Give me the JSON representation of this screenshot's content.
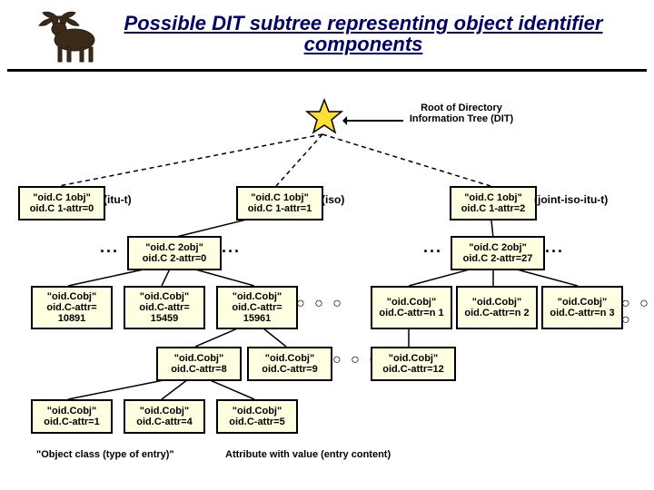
{
  "title_line": "Possible DIT subtree representing object identifier components",
  "root_label": "Root of Directory Information Tree (DIT)",
  "row1": {
    "a": {
      "l1": "\"oid.C 1obj\"",
      "l2": "oid.C 1-attr=0",
      "side": "(itu-t)"
    },
    "b": {
      "l1": "\"oid.C 1obj\"",
      "l2": "oid.C 1-attr=1",
      "side": "(iso)"
    },
    "c": {
      "l1": "\"oid.C 1obj\"",
      "l2": "oid.C 1-attr=2",
      "side": "(joint-iso-itu-t)"
    }
  },
  "row2": {
    "a": {
      "l1": "\"oid.C 2obj\"",
      "l2": "oid.C 2-attr=0"
    },
    "b": {
      "l1": "\"oid.C 2obj\"",
      "l2": "oid.C 2-attr=27"
    }
  },
  "row3": {
    "a": {
      "l1": "\"oid.Cobj\"",
      "l2": "oid.C-attr= 10891"
    },
    "b": {
      "l1": "\"oid.Cobj\"",
      "l2": "oid.C-attr= 15459"
    },
    "c": {
      "l1": "\"oid.Cobj\"",
      "l2": "oid.C-attr= 15961"
    },
    "d": {
      "l1": "\"oid.Cobj\"",
      "l2": "oid.C-attr=n 1"
    },
    "e": {
      "l1": "\"oid.Cobj\"",
      "l2": "oid.C-attr=n 2"
    },
    "f": {
      "l1": "\"oid.Cobj\"",
      "l2": "oid.C-attr=n 3"
    }
  },
  "row4": {
    "a": {
      "l1": "\"oid.Cobj\"",
      "l2": "oid.C-attr=8"
    },
    "b": {
      "l1": "\"oid.Cobj\"",
      "l2": "oid.C-attr=9"
    },
    "c": {
      "l1": "\"oid.Cobj\"",
      "l2": "oid.C-attr=12"
    }
  },
  "row5": {
    "a": {
      "l1": "\"oid.Cobj\"",
      "l2": "oid.C-attr=1"
    },
    "b": {
      "l1": "\"oid.Cobj\"",
      "l2": "oid.C-attr=4"
    },
    "c": {
      "l1": "\"oid.Cobj\"",
      "l2": "oid.C-attr=5"
    }
  },
  "legend": {
    "class_label": "\"Object class (type of entry)\"",
    "attr_label": "Attribute with value (entry content)"
  },
  "ellipsis": "..."
}
